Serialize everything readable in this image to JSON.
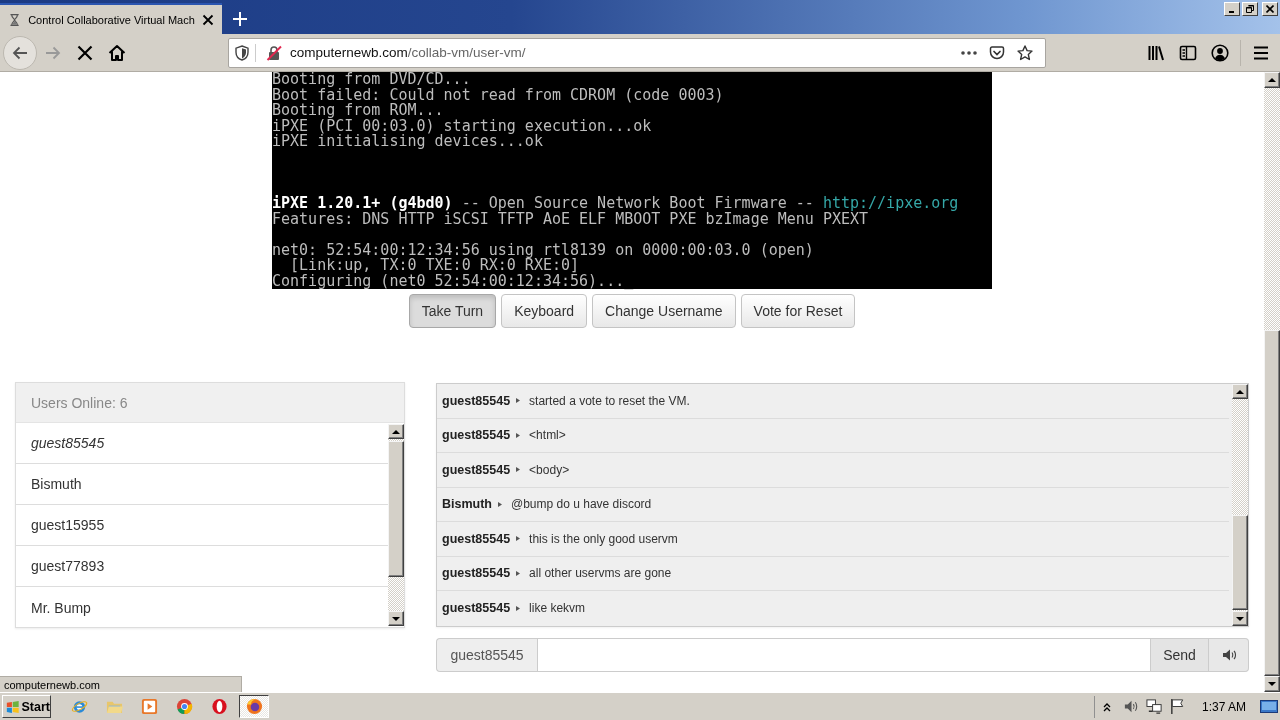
{
  "browser": {
    "tab_title": "Control Collaborative Virtual Mach",
    "loading": true,
    "back_disabled": false,
    "forward_disabled": true,
    "url": {
      "domain": "computernewb.com",
      "path": "/collab-vm/user-vm/"
    }
  },
  "vm_screen": {
    "lines": [
      {
        "kind": "text",
        "segments": [
          {
            "kind": "normal",
            "text": "Booting from DVD/CD..."
          }
        ]
      },
      {
        "kind": "text",
        "segments": [
          {
            "kind": "normal",
            "text": "Boot failed: Could not read from CDROM (code 0003)"
          }
        ]
      },
      {
        "kind": "text",
        "segments": [
          {
            "kind": "normal",
            "text": "Booting from ROM..."
          }
        ]
      },
      {
        "kind": "text",
        "segments": [
          {
            "kind": "normal",
            "text": "iPXE (PCI 00:03.0) starting execution...ok"
          }
        ]
      },
      {
        "kind": "text",
        "segments": [
          {
            "kind": "normal",
            "text": "iPXE initialising devices...ok"
          }
        ]
      },
      {
        "kind": "blank"
      },
      {
        "kind": "blank"
      },
      {
        "kind": "blank"
      },
      {
        "kind": "text",
        "segments": [
          {
            "kind": "bright",
            "text": "iPXE 1.20.1+ (g4bd0)"
          },
          {
            "kind": "normal",
            "text": " -- Open Source Network Boot Firmware -- "
          },
          {
            "kind": "link",
            "text": "http://ipxe.org"
          }
        ]
      },
      {
        "kind": "text",
        "segments": [
          {
            "kind": "normal",
            "text": "Features: DNS HTTP iSCSI TFTP AoE ELF MBOOT PXE bzImage Menu PXEXT"
          }
        ]
      },
      {
        "kind": "blank"
      },
      {
        "kind": "text",
        "segments": [
          {
            "kind": "normal",
            "text": "net0: 52:54:00:12:34:56 using rtl8139 on 0000:00:03.0 (open)"
          }
        ]
      },
      {
        "kind": "text",
        "segments": [
          {
            "kind": "normal",
            "text": "  [Link:up, TX:0 TXE:0 RX:0 RXE:0]"
          }
        ]
      },
      {
        "kind": "text",
        "segments": [
          {
            "kind": "normal",
            "text": "Configuring (net0 52:54:00:12:34:56)..._"
          }
        ]
      }
    ]
  },
  "vm_buttons": [
    {
      "label": "Take Turn",
      "pressed": true
    },
    {
      "label": "Keyboard",
      "pressed": false
    },
    {
      "label": "Change Username",
      "pressed": false
    },
    {
      "label": "Vote for Reset",
      "pressed": false
    }
  ],
  "users_panel": {
    "title": "Users Online: 6",
    "users": [
      {
        "name": "guest85545",
        "self": true
      },
      {
        "name": "Bismuth",
        "self": false
      },
      {
        "name": "guest15955",
        "self": false
      },
      {
        "name": "guest77893",
        "self": false
      },
      {
        "name": "Mr. Bump",
        "self": false
      }
    ]
  },
  "chat": {
    "messages": [
      {
        "user": "guest85545",
        "text": "started a vote to reset the VM."
      },
      {
        "user": "guest85545",
        "text": "<html>"
      },
      {
        "user": "guest85545",
        "text": "<body>"
      },
      {
        "user": "Bismuth",
        "text": "@bump do u have discord"
      },
      {
        "user": "guest85545",
        "text": "this is the only good uservm"
      },
      {
        "user": "guest85545",
        "text": "all other uservms are gone"
      },
      {
        "user": "guest85545",
        "text": "like kekvm"
      }
    ],
    "username": "guest85545",
    "send_label": "Send"
  },
  "status_text": "computernewb.com",
  "taskbar": {
    "start_label": "Start",
    "clock": "1:37 AM"
  }
}
